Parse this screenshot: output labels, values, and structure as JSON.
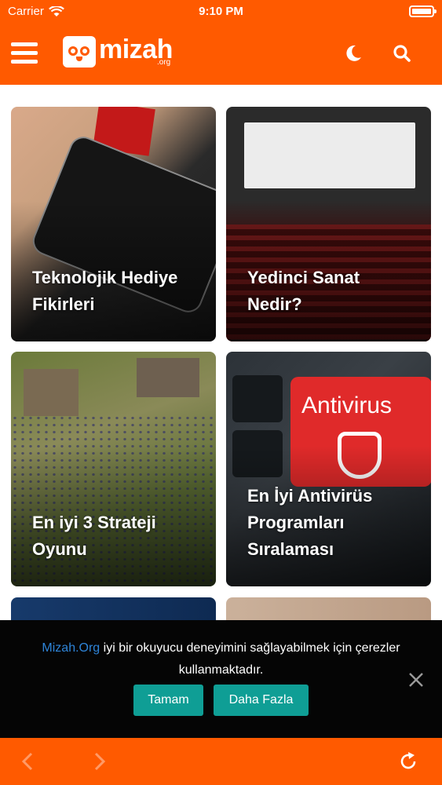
{
  "status": {
    "carrier": "Carrier",
    "time": "9:10 PM"
  },
  "header": {
    "logo_text": "mizah",
    "logo_sub": ".org",
    "icons": {
      "menu": "hamburger-menu-icon",
      "theme": "moon-icon",
      "search": "search-icon"
    }
  },
  "cards": [
    {
      "title": "Teknolojik Hediye Fikirleri"
    },
    {
      "title": "Yedinci Sanat Nedir?"
    },
    {
      "title": "En iyi 3 Strateji Oyunu"
    },
    {
      "title": "En İyi Antivirüs Programları Sıralaması",
      "image_text": "Antivirus"
    },
    {
      "title": ""
    },
    {
      "title": ""
    }
  ],
  "cookie": {
    "link_text": "Mizah.Org",
    "message": " iyi bir okuyucu deneyimini sağlayabilmek için çerezler kullanmaktadır.",
    "accept_label": "Tamam",
    "more_label": "Daha Fazla"
  },
  "bottom_bar": {
    "icons": [
      "chevron-left-icon",
      "chevron-right-icon",
      "refresh-icon"
    ]
  },
  "colors": {
    "brand": "#ff5a00",
    "button": "#0f9e95",
    "link": "#2e84d8",
    "banner": "#050505"
  }
}
